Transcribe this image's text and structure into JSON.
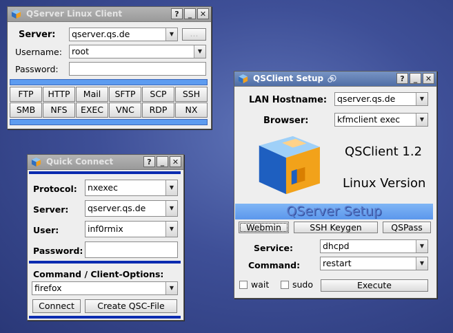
{
  "win1": {
    "title": "QServer Linux Client",
    "server_label": "Server:",
    "server_value": "qserver.qs.de",
    "username_label": "Username:",
    "username_value": "root",
    "password_label": "Password:",
    "password_value": "",
    "small_button": "...",
    "protocols": [
      "FTP",
      "HTTP",
      "Mail",
      "SFTP",
      "SCP",
      "SSH",
      "SMB",
      "NFS",
      "EXEC",
      "VNC",
      "RDP",
      "NX"
    ]
  },
  "win2": {
    "title": "Quick Connect",
    "protocol_label": "Protocol:",
    "protocol_value": "nxexec",
    "server_label": "Server:",
    "server_value": "qserver.qs.de",
    "user_label": "User:",
    "user_value": "inf0rmix",
    "password_label": "Password:",
    "password_value": "",
    "options_label": "Command / Client-Options:",
    "options_value": "firefox",
    "connect_label": "Connect",
    "create_label": "Create QSC-File"
  },
  "win3": {
    "title": "QSClient Setup",
    "lan_label": "LAN Hostname:",
    "lan_value": "qserver.qs.de",
    "browser_label": "Browser:",
    "browser_value": "kfmclient exec",
    "version": "QSClient 1.2",
    "platform": "Linux Version",
    "banner": "QServer Setup",
    "webmin_label": "Webmin",
    "sshkeygen_label": "SSH Keygen",
    "qspass_label": "QSPass",
    "service_label": "Service:",
    "service_value": "dhcpd",
    "command_label": "Command:",
    "command_value": "restart",
    "wait_label": "wait",
    "sudo_label": "sudo",
    "execute_label": "Execute"
  },
  "titlebar_buttons": {
    "help": "?",
    "minimize": "_",
    "close": "✕"
  },
  "colors": {
    "accent_blue": "#5d9cf0",
    "dark_blue": "#0a2bb0",
    "active_title": "#4f6ea6"
  }
}
